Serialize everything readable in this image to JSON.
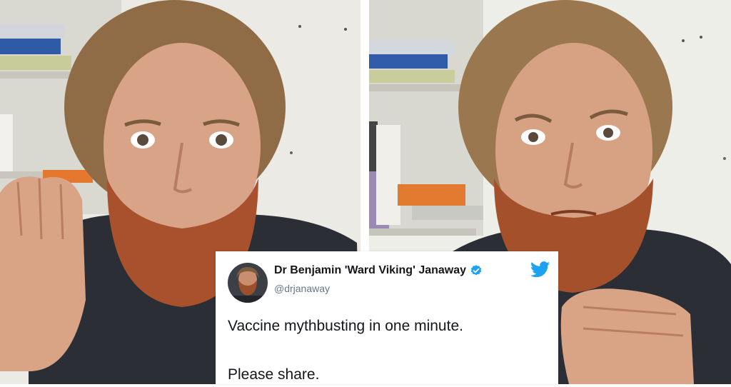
{
  "tweet": {
    "display_name": "Dr Benjamin 'Ward Viking' Janaway",
    "handle": "@drjanaway",
    "lines": [
      "Vaccine mythbusting in one minute.",
      "Please share."
    ],
    "verified": true
  },
  "icons": {
    "verified": "verified-badge-icon",
    "platform": "twitter-bird-icon"
  },
  "colors": {
    "brand": "#1da1f2",
    "text": "#14171a",
    "handle": "#657786",
    "beard": "#a8512c",
    "sweater": "#2b2f35",
    "wall": "#ecebe6"
  }
}
